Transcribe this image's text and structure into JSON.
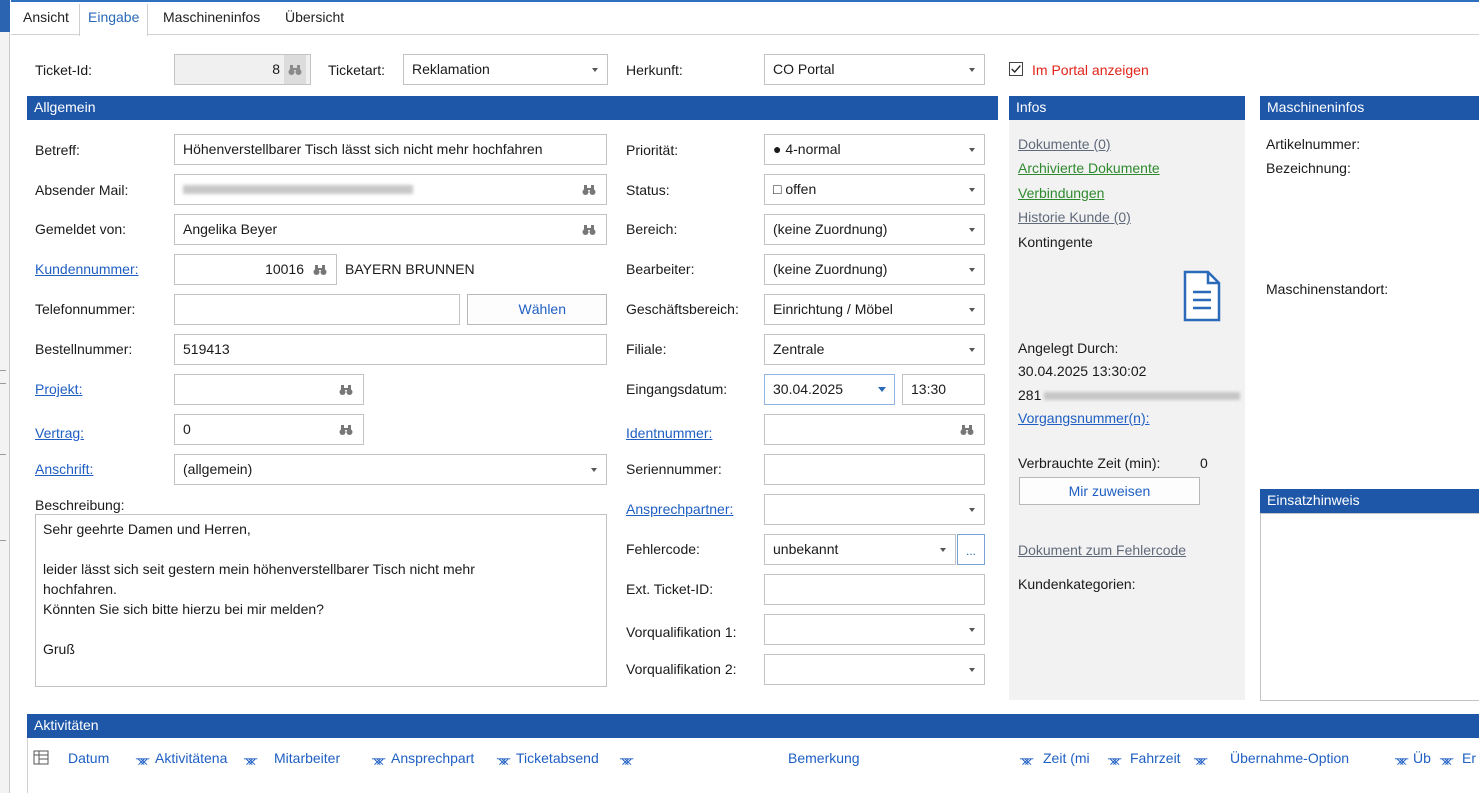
{
  "tabs": [
    "Ansicht",
    "Eingabe",
    "Maschineninfos",
    "Übersicht"
  ],
  "top": {
    "ticket_id_label": "Ticket-Id:",
    "ticket_id_value": "8",
    "ticketart_label": "Ticketart:",
    "ticketart_value": "Reklamation",
    "herkunft_label": "Herkunft:",
    "herkunft_value": "CO Portal",
    "portal_checkbox_label": "Im Portal anzeigen",
    "portal_checked": true
  },
  "allgemein": {
    "header": "Allgemein",
    "betreff_label": "Betreff:",
    "betreff_value": "Höhenverstellbarer Tisch lässt sich nicht mehr hochfahren",
    "absender_label": "Absender Mail:",
    "absender_value": "",
    "gemeldet_label": "Gemeldet von:",
    "gemeldet_value": "Angelika Beyer",
    "kundennummer_label": "Kundennummer:",
    "kundennummer_value": "10016",
    "kunde_name": "BAYERN BRUNNEN",
    "telefon_label": "Telefonnummer:",
    "telefon_value": "",
    "waehlen_button": "Wählen",
    "bestell_label": "Bestellnummer:",
    "bestell_value": "519413",
    "projekt_label": "Projekt:",
    "projekt_value": "",
    "vertrag_label": "Vertrag:",
    "vertrag_value": "0",
    "anschrift_label": "Anschrift:",
    "anschrift_value": "(allgemein)",
    "beschreibung_label": "Beschreibung:",
    "beschreibung_lines": [
      "Sehr geehrte Damen und Herren,",
      "",
      "leider lässt sich seit gestern mein höhenverstellbarer Tisch nicht mehr",
      "hochfahren.",
      "Könnten Sie sich bitte hierzu bei mir melden?",
      "",
      "Gruß"
    ],
    "prioritaet_label": "Priorität:",
    "prioritaet_value": "● 4-normal",
    "status_label": "Status:",
    "status_value": "□ offen",
    "bereich_label": "Bereich:",
    "bereich_value": "(keine Zuordnung)",
    "bearbeiter_label": "Bearbeiter:",
    "bearbeiter_value": "(keine Zuordnung)",
    "geschaeft_label": "Geschäftsbereich:",
    "geschaeft_value": "Einrichtung / Möbel",
    "filiale_label": "Filiale:",
    "filiale_value": "Zentrale",
    "eingang_label": "Eingangsdatum:",
    "eingang_date": "30.04.2025",
    "eingang_time": "13:30",
    "ident_label": "Identnummer:",
    "ident_value": "",
    "serien_label": "Seriennummer:",
    "serien_value": "",
    "ansprech_label": "Ansprechpartner:",
    "ansprech_value": "",
    "fehler_label": "Fehlercode:",
    "fehler_value": "unbekannt",
    "fehler_more": "...",
    "extticket_label": "Ext. Ticket-ID:",
    "extticket_value": "",
    "vorq1_label": "Vorqualifikation 1:",
    "vorq1_value": "",
    "vorq2_label": "Vorqualifikation 2:",
    "vorq2_value": ""
  },
  "infos": {
    "header": "Infos",
    "dokumente": "Dokumente (0)",
    "archiviert": "Archivierte Dokumente",
    "verbindungen": "Verbindungen",
    "historie": "Historie Kunde (0)",
    "kontingente": "Kontingente",
    "angelegt_label": "Angelegt Durch:",
    "angelegt_datetime": "30.04.2025 13:30:02",
    "angelegt_user_prefix": "281",
    "vorgang": "Vorgangsnummer(n):",
    "verbraucht_label": "Verbrauchte Zeit (min):",
    "verbraucht_value": "0",
    "zuweisen_button": "Mir zuweisen",
    "fehlercode_doc": "Dokument zum Fehlercode",
    "kundenkat": "Kundenkategorien:"
  },
  "maschineninfos": {
    "header": "Maschineninfos",
    "artikel_label": "Artikelnummer:",
    "bezeichnung_label": "Bezeichnung:",
    "standort_label": "Maschinenstandort:"
  },
  "einsatz": {
    "header": "Einsatzhinweis"
  },
  "aktivitaeten": {
    "header": "Aktivitäten",
    "columns": [
      "Datum",
      "Aktivitätena",
      "Mitarbeiter",
      "Ansprechpart",
      "Ticketabsend",
      "Bemerkung",
      "Zeit (mi",
      "Fahrzeit",
      "Übernahme-Option",
      "Üb",
      "Er"
    ]
  }
}
